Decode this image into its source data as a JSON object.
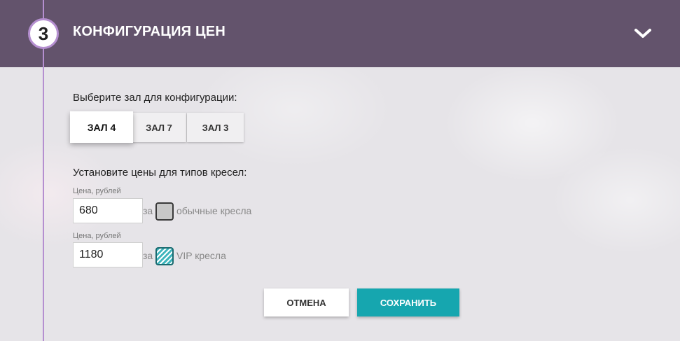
{
  "header": {
    "step_number": "3",
    "title": "КОНФИГУРАЦИЯ ЦЕН",
    "toggle_icon": "chevron-down-icon"
  },
  "hall_select": {
    "label": "Выберите зал для конфигурации:",
    "halls": [
      {
        "label": "ЗАЛ 4",
        "active": true
      },
      {
        "label": "ЗАЛ 7",
        "active": false
      },
      {
        "label": "ЗАЛ 3",
        "active": false
      }
    ]
  },
  "prices": {
    "label": "Установите цены для типов кресел:",
    "rows": [
      {
        "caption": "Цена, рублей",
        "value": "680",
        "for_text": "за",
        "seat_label": "обычные кресла",
        "seat_type": "regular"
      },
      {
        "caption": "Цена, рублей",
        "value": "1180",
        "for_text": "за",
        "seat_label": "VIP кресла",
        "seat_type": "vip"
      }
    ]
  },
  "actions": {
    "cancel_label": "ОТМЕНА",
    "save_label": "СОХРАНИТЬ"
  },
  "colors": {
    "header_bg": "#63536c",
    "timeline": "#b58fd0",
    "accent": "#16a6af"
  }
}
